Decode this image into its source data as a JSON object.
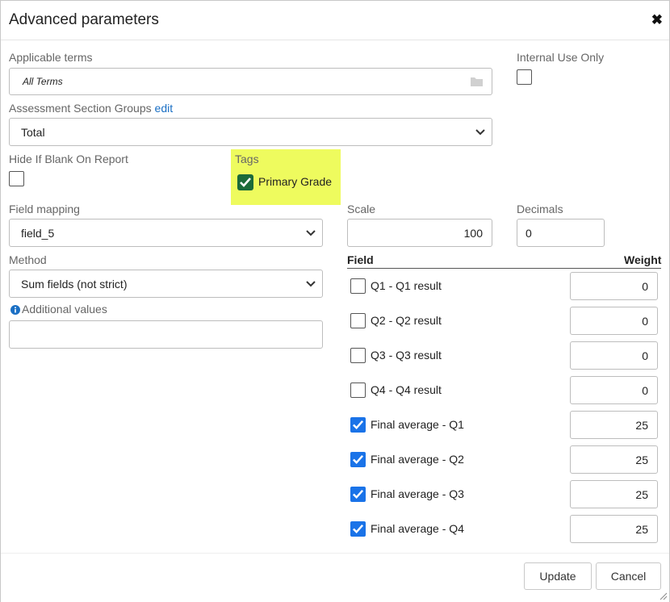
{
  "dialog": {
    "title": "Advanced parameters",
    "close_glyph": "✖"
  },
  "applicable_terms": {
    "label": "Applicable terms",
    "value": "All Terms",
    "icon": "folder-icon"
  },
  "internal_use": {
    "label": "Internal Use Only",
    "checked": false
  },
  "assessment_groups": {
    "label": "Assessment Section Groups",
    "edit_link": "edit",
    "selected": "Total"
  },
  "hide_if_blank": {
    "label": "Hide If Blank On Report",
    "checked": false
  },
  "tags": {
    "label": "Tags",
    "primary_grade": "Primary Grade",
    "checked": true,
    "highlight_color": "#eefb5e"
  },
  "field_mapping": {
    "label": "Field mapping",
    "selected": "field_5"
  },
  "scale": {
    "label": "Scale",
    "value": "100"
  },
  "decimals": {
    "label": "Decimals",
    "value": "0"
  },
  "method": {
    "label": "Method",
    "selected": "Sum fields (not strict)"
  },
  "additional_values": {
    "label": "Additional values",
    "value": ""
  },
  "fields_table": {
    "header_field": "Field",
    "header_weight": "Weight",
    "rows": [
      {
        "label": "Q1 - Q1 result",
        "checked": false,
        "weight": "0"
      },
      {
        "label": "Q2 - Q2 result",
        "checked": false,
        "weight": "0"
      },
      {
        "label": "Q3 - Q3 result",
        "checked": false,
        "weight": "0"
      },
      {
        "label": "Q4 - Q4 result",
        "checked": false,
        "weight": "0"
      },
      {
        "label": "Final average - Q1",
        "checked": true,
        "weight": "25"
      },
      {
        "label": "Final average - Q2",
        "checked": true,
        "weight": "25"
      },
      {
        "label": "Final average - Q3",
        "checked": true,
        "weight": "25"
      },
      {
        "label": "Final average - Q4",
        "checked": true,
        "weight": "25"
      }
    ]
  },
  "footer": {
    "update_label": "Update",
    "cancel_label": "Cancel"
  },
  "colors": {
    "accent": "#1a73e8",
    "link": "#1a6fc4",
    "tag_check": "#1b6b3a"
  }
}
